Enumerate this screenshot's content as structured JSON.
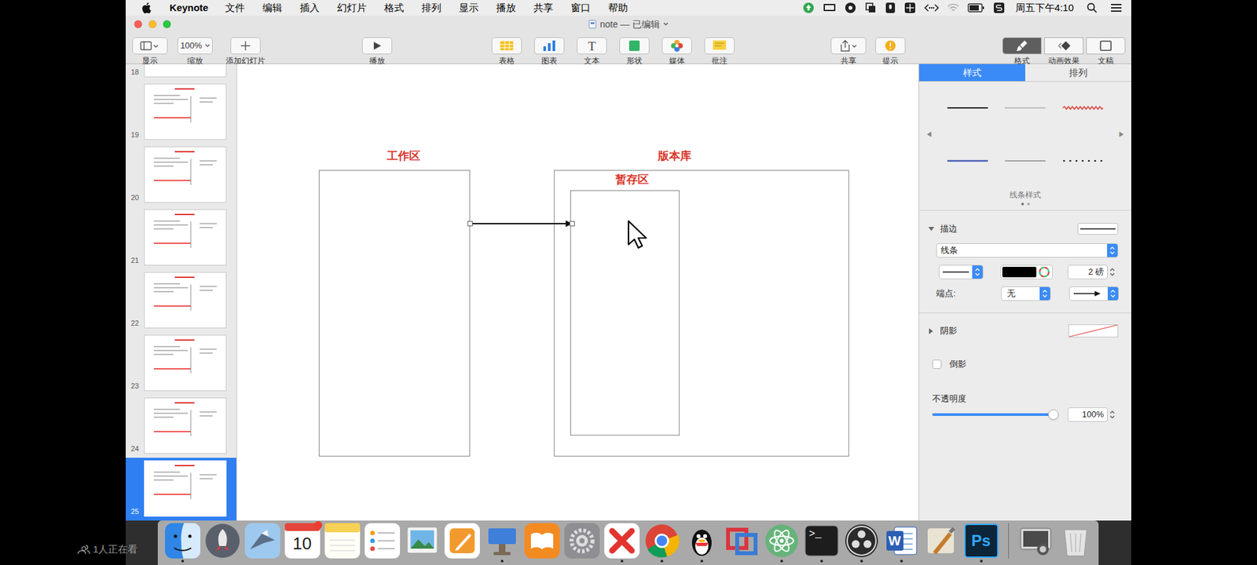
{
  "menubar": {
    "app": "Keynote",
    "menus": [
      "文件",
      "编辑",
      "插入",
      "幻灯片",
      "格式",
      "排列",
      "显示",
      "播放",
      "共享",
      "窗口",
      "帮助"
    ],
    "clock": "周五下午4:10"
  },
  "window": {
    "title": "note — 已编辑"
  },
  "toolbar": {
    "groups": [
      [
        {
          "label": "显示",
          "kind": "view"
        },
        {
          "label": "缩放",
          "kind": "zoom",
          "value": "100%"
        },
        {
          "label": "添加幻灯片",
          "kind": "add"
        }
      ],
      [
        {
          "label": "播放",
          "kind": "play"
        }
      ],
      [
        {
          "label": "表格",
          "kind": "table"
        },
        {
          "label": "图表",
          "kind": "chart"
        },
        {
          "label": "文本",
          "kind": "text",
          "glyph": "T"
        },
        {
          "label": "形状",
          "kind": "shape"
        },
        {
          "label": "媒体",
          "kind": "media"
        },
        {
          "label": "批注",
          "kind": "comment"
        }
      ],
      [
        {
          "label": "共享",
          "kind": "share"
        },
        {
          "label": "提示",
          "kind": "tip"
        }
      ],
      [
        {
          "label": "格式",
          "kind": "format",
          "selected": true
        },
        {
          "label": "动画效果",
          "kind": "animate",
          "selected": false
        },
        {
          "label": "文稿",
          "kind": "document",
          "selected": false
        }
      ]
    ]
  },
  "slides": [
    {
      "number": "18",
      "selected": false
    },
    {
      "number": "19",
      "selected": false
    },
    {
      "number": "20",
      "selected": false
    },
    {
      "number": "21",
      "selected": false
    },
    {
      "number": "22",
      "selected": false
    },
    {
      "number": "23",
      "selected": false
    },
    {
      "number": "24",
      "selected": false
    },
    {
      "number": "25",
      "selected": true
    }
  ],
  "canvas": {
    "work_area": {
      "label": "工作区"
    },
    "repository": {
      "label": "版本库"
    },
    "staging": {
      "label": "暂存区"
    },
    "arrow": {
      "selected": true
    }
  },
  "inspector": {
    "tabs": [
      {
        "label": "样式",
        "selected": true
      },
      {
        "label": "排列",
        "selected": false
      }
    ],
    "line_styles": {
      "prev": "◀",
      "next": "▶",
      "items": [
        {
          "kind": "solid"
        },
        {
          "kind": "thin"
        },
        {
          "kind": "fancy-red"
        },
        {
          "kind": "blue"
        },
        {
          "kind": "gray"
        },
        {
          "kind": "dotted"
        }
      ],
      "caption": "线条样式",
      "pages": [
        {
          "selected": true
        },
        {
          "selected": false
        }
      ]
    },
    "stroke": {
      "label": "描边",
      "expanded": true,
      "type": "线条",
      "line": "solid",
      "color": "#000000",
      "width": "2 磅",
      "endpoints_label": "端点:",
      "start": "无",
      "end": "arrow"
    },
    "shadow": {
      "label": "阴影",
      "expanded": false
    },
    "reflection": {
      "label": "倒影",
      "checked": false
    },
    "opacity": {
      "label": "不透明度",
      "level": 1,
      "reading": "100%"
    }
  },
  "dock": {
    "items": [
      {
        "kind": "finder",
        "running": true
      },
      {
        "kind": "launchpad",
        "running": false
      },
      {
        "kind": "mail",
        "running": false
      },
      {
        "kind": "calendar",
        "glyph": "10",
        "badge": true,
        "running": false
      },
      {
        "kind": "notes",
        "running": false
      },
      {
        "kind": "reminders",
        "running": false
      },
      {
        "kind": "preview",
        "running": false
      },
      {
        "kind": "pages",
        "running": false
      },
      {
        "kind": "keynote",
        "running": true
      },
      {
        "kind": "ibooks",
        "running": false
      },
      {
        "kind": "settings",
        "running": false
      },
      {
        "kind": "xmind",
        "running": true
      },
      {
        "kind": "chrome",
        "running": true
      },
      {
        "kind": "qq",
        "running": true
      },
      {
        "kind": "parallels",
        "running": false
      },
      {
        "kind": "atom",
        "running": true
      },
      {
        "kind": "terminal",
        "glyph": ">_",
        "running": true
      },
      {
        "kind": "obs",
        "running": true
      },
      {
        "kind": "word",
        "glyph": "W",
        "running": true
      },
      {
        "kind": "tools",
        "running": false
      },
      {
        "kind": "photoshop",
        "glyph": "Ps",
        "running": true
      },
      {
        "kind": "separator",
        "running": false
      },
      {
        "kind": "screenshot",
        "running": false
      },
      {
        "kind": "trash",
        "running": false
      }
    ]
  },
  "overlay": {
    "viewers": "1人正在看"
  }
}
